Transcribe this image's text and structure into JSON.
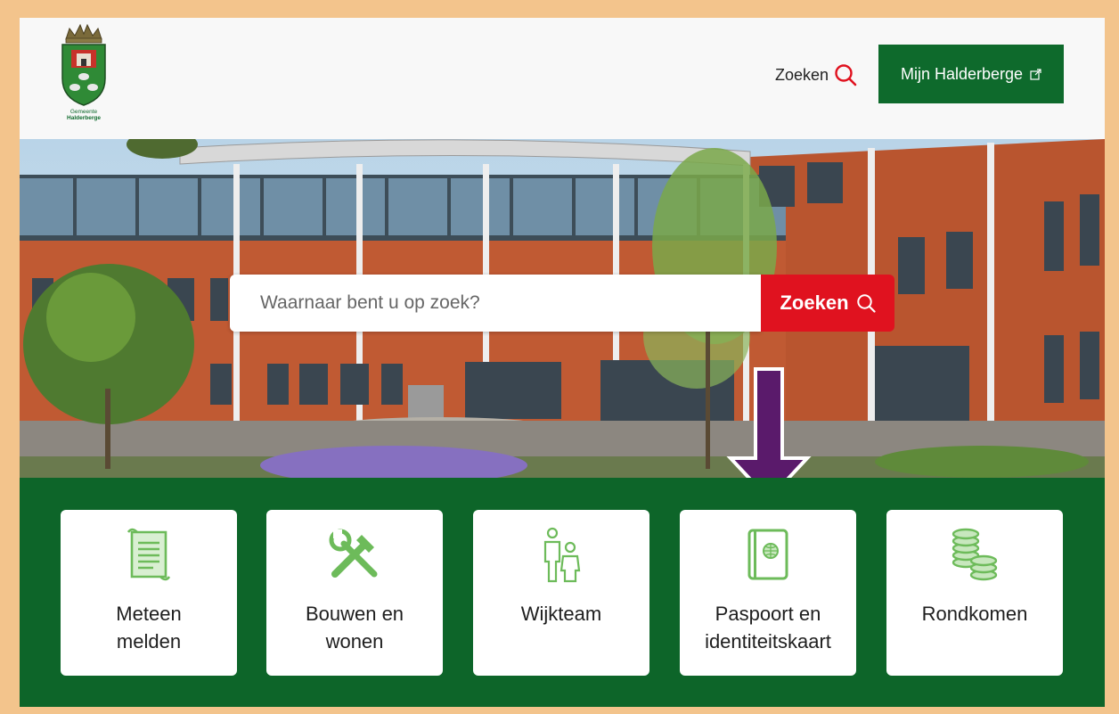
{
  "header": {
    "logo_lines": [
      "Gemeente",
      "Halderberge"
    ],
    "search_label": "Zoeken",
    "mijn_button": "Mijn Halderberge"
  },
  "hero": {
    "search_placeholder": "Waarnaar bent u op zoek?",
    "search_button": "Zoeken"
  },
  "tiles": [
    {
      "line1": "Meteen",
      "line2": "melden",
      "icon": "scroll-icon"
    },
    {
      "line1": "Bouwen en",
      "line2": "wonen",
      "icon": "tools-icon"
    },
    {
      "line1": "Wijkteam",
      "line2": "",
      "icon": "people-icon"
    },
    {
      "line1": "Paspoort en",
      "line2": "identiteitskaart",
      "icon": "passport-icon"
    },
    {
      "line1": "Rondkomen",
      "line2": "",
      "icon": "coins-icon"
    }
  ],
  "colors": {
    "brand_green": "#0d6529",
    "icon_green": "#6dbb5a",
    "search_red": "#e0121f",
    "frame": "#f3c48c",
    "annotation_arrow": "#5a1a6b"
  }
}
